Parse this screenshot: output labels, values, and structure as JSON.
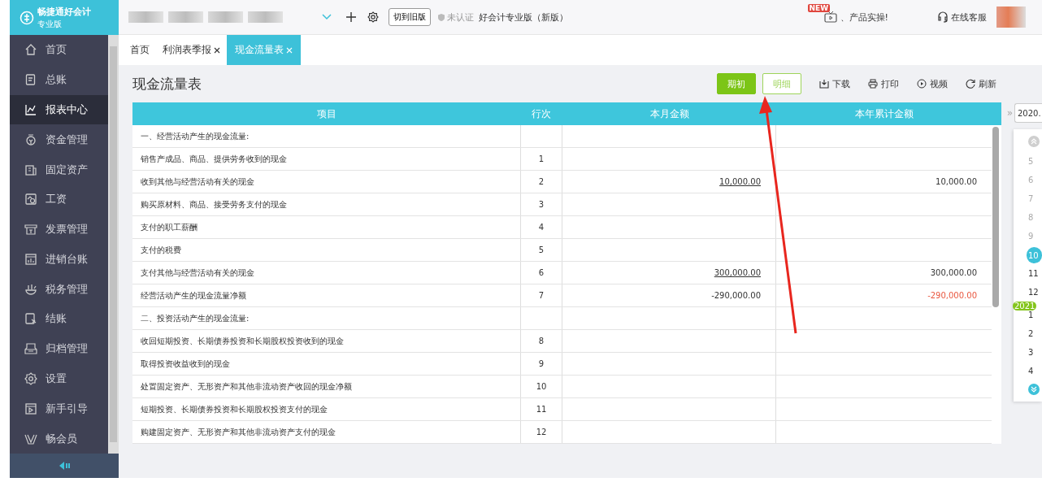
{
  "logo": {
    "name": "畅捷通好会计",
    "edition": "专业版"
  },
  "header": {
    "old_version_button": "切到旧版",
    "certification": "未认证",
    "product": "好会计专业版（新版）",
    "news_badge": "NEW",
    "news": "、产品实操!",
    "support": "在线客服"
  },
  "sidebar": {
    "items": [
      {
        "label": "首页",
        "selected": false
      },
      {
        "label": "总账",
        "selected": false
      },
      {
        "label": "报表中心",
        "selected": true
      },
      {
        "label": "资金管理",
        "selected": false
      },
      {
        "label": "固定资产",
        "selected": false
      },
      {
        "label": "工资",
        "selected": false
      },
      {
        "label": "发票管理",
        "selected": false
      },
      {
        "label": "进销台账",
        "selected": false
      },
      {
        "label": "税务管理",
        "selected": false
      },
      {
        "label": "结账",
        "selected": false
      },
      {
        "label": "归档管理",
        "selected": false
      },
      {
        "label": "设置",
        "selected": false
      },
      {
        "label": "新手引导",
        "selected": false
      },
      {
        "label": "畅会员",
        "selected": false
      }
    ]
  },
  "tabs": [
    {
      "label": "首页",
      "closable": false,
      "selected": false
    },
    {
      "label": "利润表季报",
      "closable": true,
      "selected": false
    },
    {
      "label": "现金流量表",
      "closable": true,
      "selected": true
    }
  ],
  "page": {
    "title": "现金流量表"
  },
  "toolbar": [
    {
      "kind": "primary",
      "label": "期初"
    },
    {
      "kind": "outline",
      "label": "明细"
    },
    {
      "kind": "download",
      "label": "下载"
    },
    {
      "kind": "print",
      "label": "打印"
    },
    {
      "kind": "video",
      "label": "视频"
    },
    {
      "kind": "refresh",
      "label": "刷新"
    }
  ],
  "table": {
    "columns": [
      "项目",
      "行次",
      "本月金额",
      "本年累计金额"
    ],
    "rows": [
      {
        "item": "一、经营活动产生的现金流量:"
      },
      {
        "item": "销售产成品、商品、提供劳务收到的现金",
        "line": "1"
      },
      {
        "item": "收到其他与经营活动有关的现金",
        "line": "2",
        "month": {
          "text": "10,000.00",
          "linked": true
        },
        "year": {
          "text": "10,000.00",
          "negative": false
        }
      },
      {
        "item": "购买原材料、商品、接受劳务支付的现金",
        "line": "3"
      },
      {
        "item": "支付的职工薪酬",
        "line": "4"
      },
      {
        "item": "支付的税费",
        "line": "5"
      },
      {
        "item": "支付其他与经营活动有关的现金",
        "line": "6",
        "month": {
          "text": "300,000.00",
          "linked": true
        },
        "year": {
          "text": "300,000.00",
          "negative": false
        }
      },
      {
        "item": "经营活动产生的现金流量净额",
        "line": "7",
        "month": {
          "text": "-290,000.00",
          "linked": false
        },
        "year": {
          "text": "-290,000.00",
          "negative": true
        }
      },
      {
        "item": "二、投资活动产生的现金流量:"
      },
      {
        "item": "收回短期投资、长期债券投资和长期股权投资收到的现金",
        "line": "8"
      },
      {
        "item": "取得投资收益收到的现金",
        "line": "9"
      },
      {
        "item": "处置固定资产、无形资产和其他非流动资产收回的现金净额",
        "line": "10"
      },
      {
        "item": "短期投资、长期债券投资和长期股权投资支付的现金",
        "line": "11"
      },
      {
        "item": "购建固定资产、无形资产和其他非流动资产支付的现金",
        "line": "12"
      }
    ]
  },
  "period_picker": {
    "expand": "»",
    "date": "2020.",
    "months": [
      {
        "label": "5",
        "disabled": true,
        "selected": false
      },
      {
        "label": "6",
        "disabled": true,
        "selected": false
      },
      {
        "label": "7",
        "disabled": true,
        "selected": false
      },
      {
        "label": "8",
        "disabled": true,
        "selected": false
      },
      {
        "label": "9",
        "disabled": true,
        "selected": false
      },
      {
        "label": "10",
        "disabled": false,
        "selected": true
      },
      {
        "label": "11",
        "disabled": false,
        "selected": false
      },
      {
        "label": "12",
        "disabled": false,
        "selected": false
      },
      {
        "label": "1",
        "disabled": false,
        "selected": false,
        "year_badge": "2021"
      },
      {
        "label": "2",
        "disabled": false,
        "selected": false
      },
      {
        "label": "3",
        "disabled": false,
        "selected": false
      },
      {
        "label": "4",
        "disabled": false,
        "selected": false
      }
    ]
  }
}
